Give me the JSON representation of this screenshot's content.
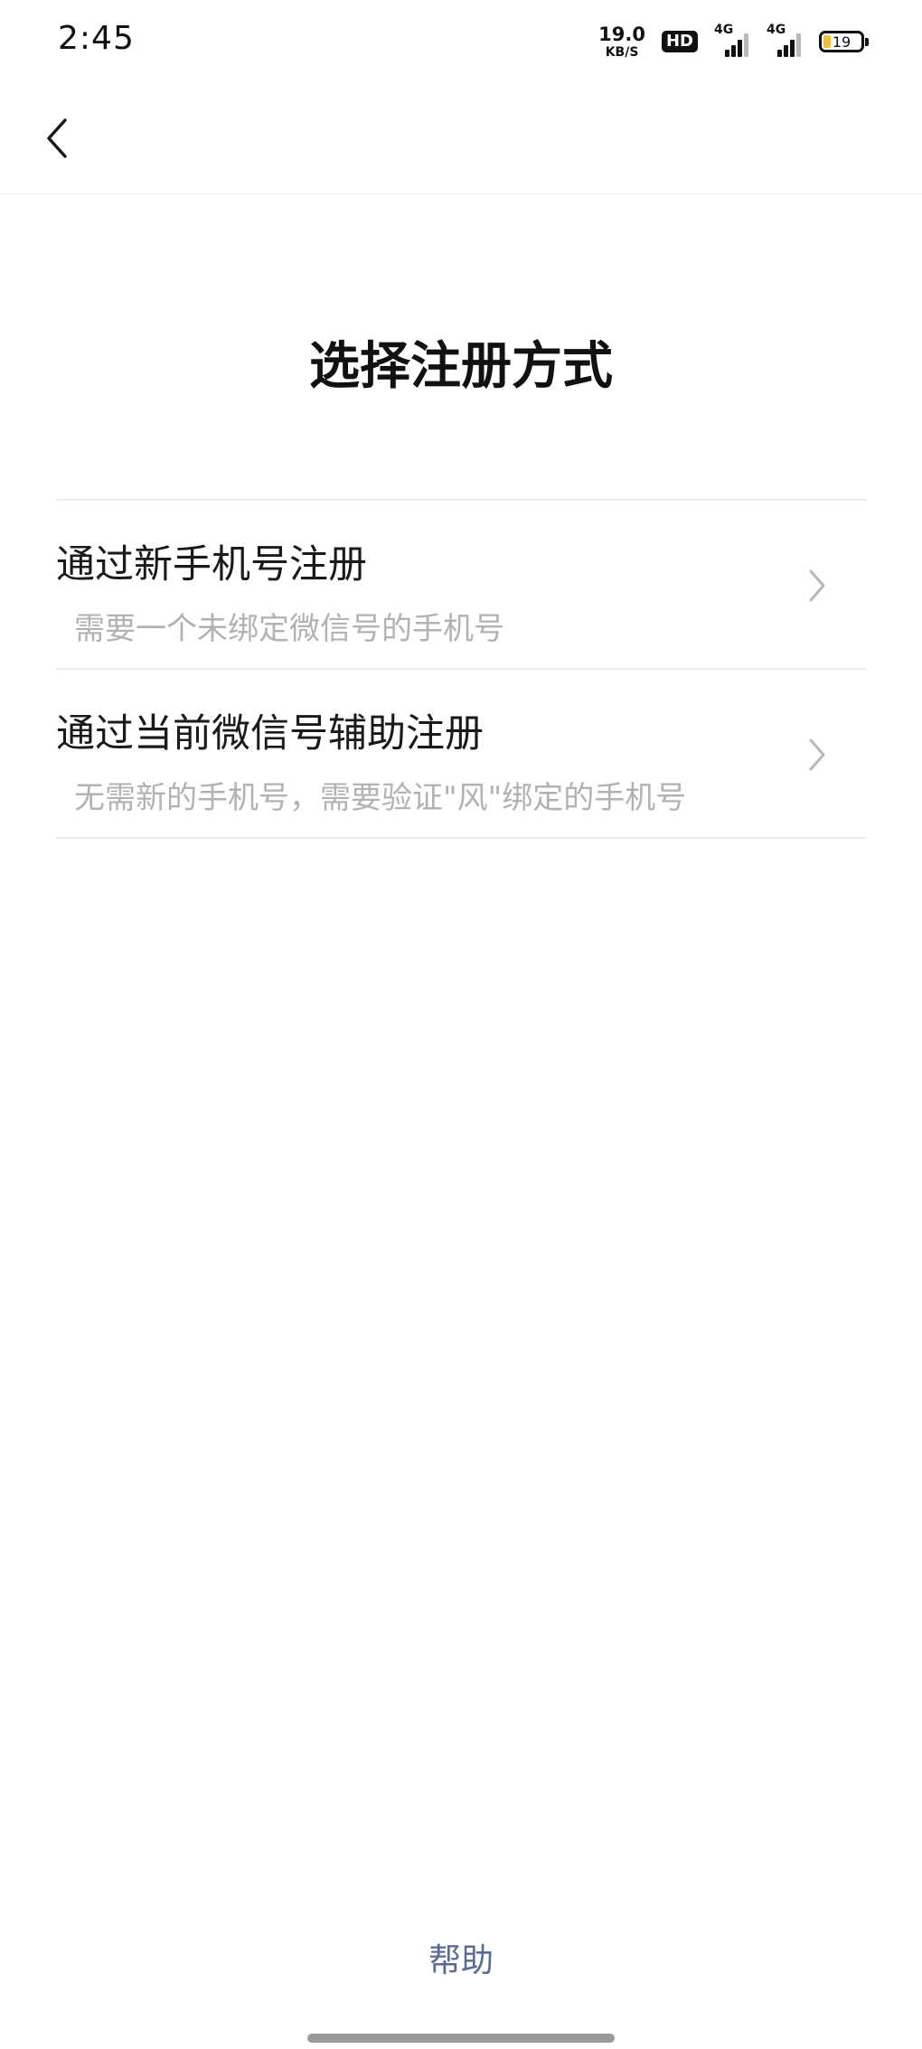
{
  "status_bar": {
    "time": "2:45",
    "net_speed_value": "19.0",
    "net_speed_unit": "KB/S",
    "hd_label": "HD",
    "sim1_label": "4G",
    "sim2_label": "4G",
    "battery_level": "19",
    "battery_fill_fraction": 0.19,
    "battery_color": "#f2c230",
    "icons": [
      "hd-voice-icon",
      "signal-icon",
      "signal-icon",
      "battery-icon"
    ]
  },
  "nav": {
    "back_icon": "chevron-left-icon"
  },
  "page": {
    "title": "选择注册方式"
  },
  "options": [
    {
      "title": "通过新手机号注册",
      "description": "需要一个未绑定微信号的手机号",
      "icon": "chevron-right-icon"
    },
    {
      "title": "通过当前微信号辅助注册",
      "description": "无需新的手机号，需要验证\"风\"绑定的手机号",
      "icon": "chevron-right-icon"
    }
  ],
  "footer": {
    "help_label": "帮助",
    "link_color": "#576b95"
  }
}
